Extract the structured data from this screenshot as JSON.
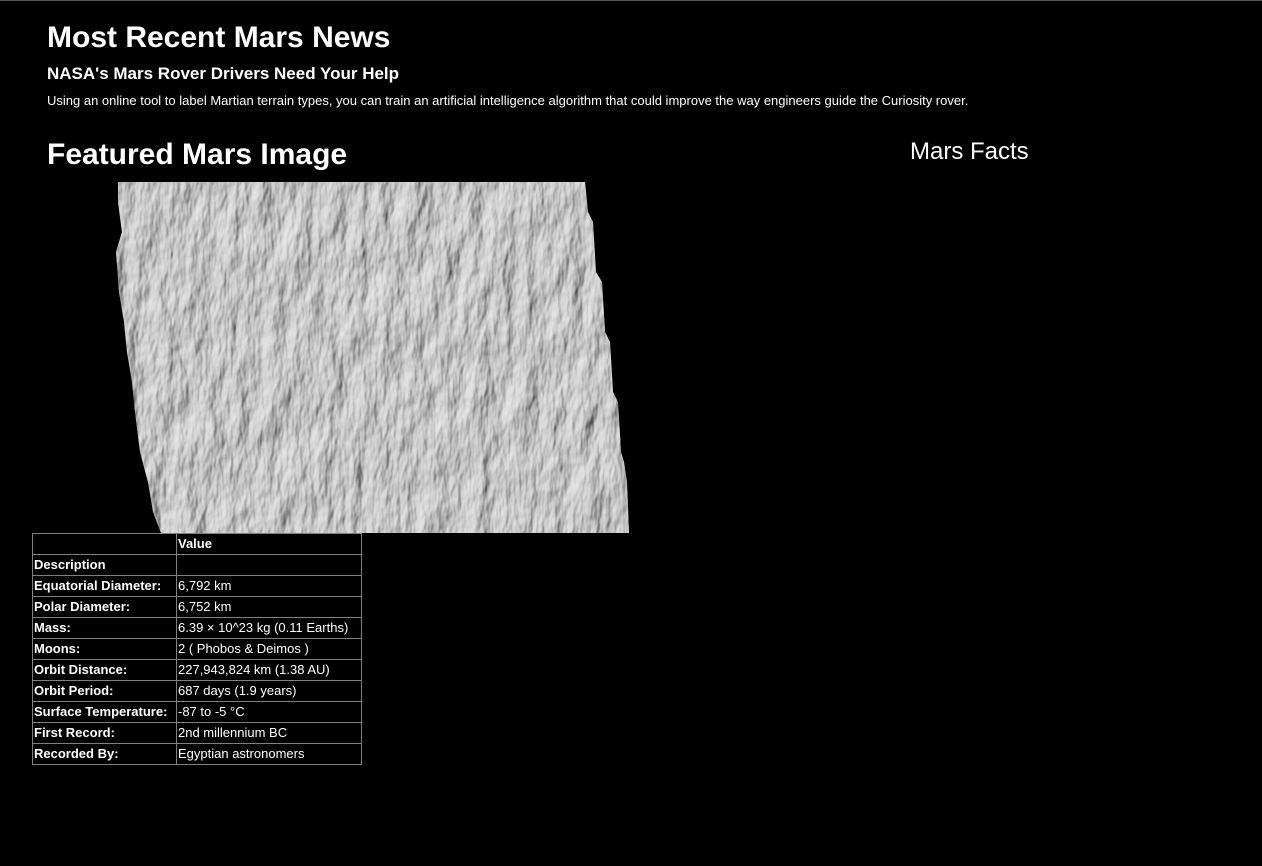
{
  "news": {
    "section_title": "Most Recent Mars News",
    "headline": "NASA's Mars Rover Drivers Need Your Help",
    "teaser": "Using an online tool to label Martian terrain types, you can train an artificial intelligence algorithm that could improve the way engineers guide the Curiosity rover."
  },
  "featured": {
    "section_title": "Featured Mars Image",
    "image_subject": "grayscale Mars surface dunes terrain"
  },
  "facts": {
    "section_title": "Mars Facts",
    "header_col1": "",
    "header_col2": "Value",
    "index_label": "Description",
    "rows": [
      {
        "label": "Equatorial Diameter:",
        "value": "6,792 km"
      },
      {
        "label": "Polar Diameter:",
        "value": "6,752 km"
      },
      {
        "label": "Mass:",
        "value": "6.39 × 10^23 kg (0.11 Earths)"
      },
      {
        "label": "Moons:",
        "value": "2 ( Phobos & Deimos )"
      },
      {
        "label": "Orbit Distance:",
        "value": "227,943,824 km (1.38 AU)"
      },
      {
        "label": "Orbit Period:",
        "value": "687 days (1.9 years)"
      },
      {
        "label": "Surface Temperature:",
        "value": "-87 to -5 °C"
      },
      {
        "label": "First Record:",
        "value": "2nd millennium BC"
      },
      {
        "label": "Recorded By:",
        "value": "Egyptian astronomers"
      }
    ]
  },
  "colors": {
    "background": "#000000",
    "text": "#ffffff",
    "table_border": "#808080"
  }
}
